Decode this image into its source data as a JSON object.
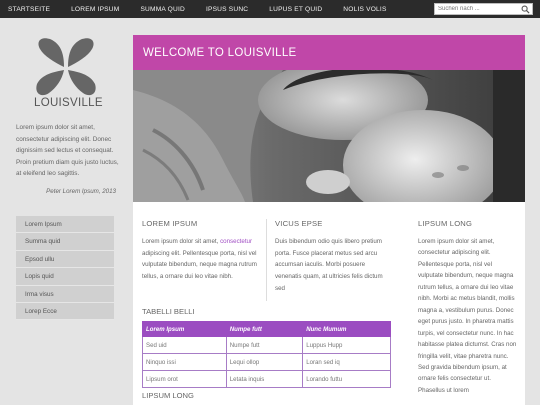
{
  "nav": {
    "items": [
      "STARTSEITE",
      "LOREM IPSUM",
      "SUMMA QUID",
      "IPSUS SUNC",
      "LUPUS ET QUID",
      "NOLIS VOLIS"
    ],
    "search_placeholder": "Suchen nach ..."
  },
  "sidebar": {
    "brand": "LOUISVILLE",
    "intro": "Lorem ipsum dolor sit amet, consectetur adipiscing elit. Donec dignissim sed lectus et consequat. Proin pretium diam quis justo luctus, at eleifend leo sagittis.",
    "quote_author": "Peter Lorem Ipsum, 2013",
    "menu": [
      "Lorem Ipsum",
      "Summa quid",
      "Epsod ullu",
      "Lopis quid",
      "Irma visus",
      "Lorep Ecce"
    ]
  },
  "main": {
    "welcome": "WELCOME TO LOUISVILLE",
    "col1": {
      "heading": "LOREM IPSUM",
      "text_before": "Lorem ipsum dolor sit amet, ",
      "link": "consectetur",
      "text_after": " adipiscing elit. Pellentesque porta, nisl vel vulputate bibendum, neque magna rutrum tellus, a ornare dui leo vitae nibh."
    },
    "col2": {
      "heading": "VICUS EPSE",
      "text": "Duis bibendum odio quis libero pretium porta. Fusce placerat metus sed arcu accumsan iaculis. Morbi posuere venenatis quam, at ultricies felis dictum sed"
    },
    "col3": {
      "heading": "LIPSUM LONG",
      "text": "Lorem ipsum dolor sit amet, consectetur adipiscing elit. Pellentesque porta, nisl vel vulputate bibendum, neque magna rutrum tellus, a ornare dui leo vitae nibh. Morbi ac metus blandit, mollis magna a, vestibulum purus. Donec eget purus justo. In pharetra mattis turpis, vel consectetur nunc. In hac habitasse platea dictumst. Cras non fringilla velit, vitae pharetra nunc. Sed gravida bibendum ipsum, at ornare felis consectetur ut. Phasellus ut lorem"
    },
    "table": {
      "title": "TABELLI BELLI",
      "headers": [
        "Lorem Ipsum",
        "Numpe futt",
        "Nunc Mumum"
      ],
      "rows": [
        [
          "Sed uid",
          "Numpe futt",
          "Luppus Hupp"
        ],
        [
          "Ninquo issi",
          "Lequi ollop",
          "Loran sed iq"
        ],
        [
          "Lipsum orot",
          "Letata inquis",
          "Lorando futtu"
        ]
      ]
    },
    "bottom_heading": "LIPSUM LONG"
  },
  "colors": {
    "accent": "#c047a8",
    "table_header": "#9b4dc1",
    "topbar": "#2b2b2b",
    "logo": "#666666"
  }
}
